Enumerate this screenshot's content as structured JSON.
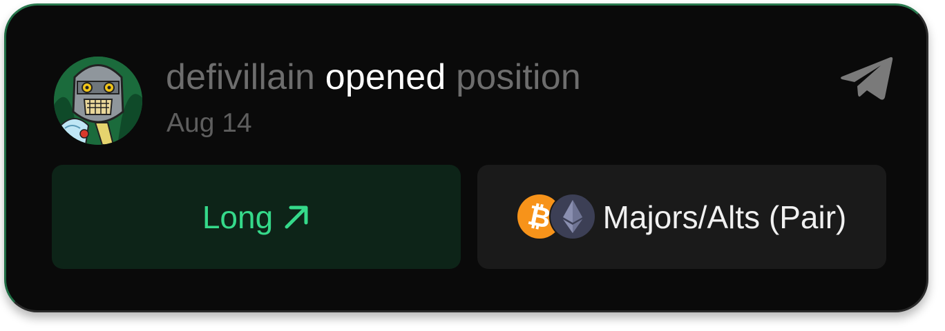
{
  "post": {
    "username": "defivillain",
    "action": "opened",
    "object": "position",
    "date": "Aug 14"
  },
  "icons": {
    "share": "telegram-send-icon",
    "direction": "arrow-up-right-icon",
    "coin1": "bitcoin-icon",
    "coin2": "ethereum-icon"
  },
  "position": {
    "side_label": "Long",
    "pair_label": "Majors/Alts (Pair)"
  },
  "colors": {
    "card_bg": "#0a0a0a",
    "long_green": "#35d98a",
    "long_bg": "#0d2418",
    "pair_bg": "#1a1a1a",
    "muted_text": "#6d6d6d",
    "btc_orange": "#f7931a"
  }
}
